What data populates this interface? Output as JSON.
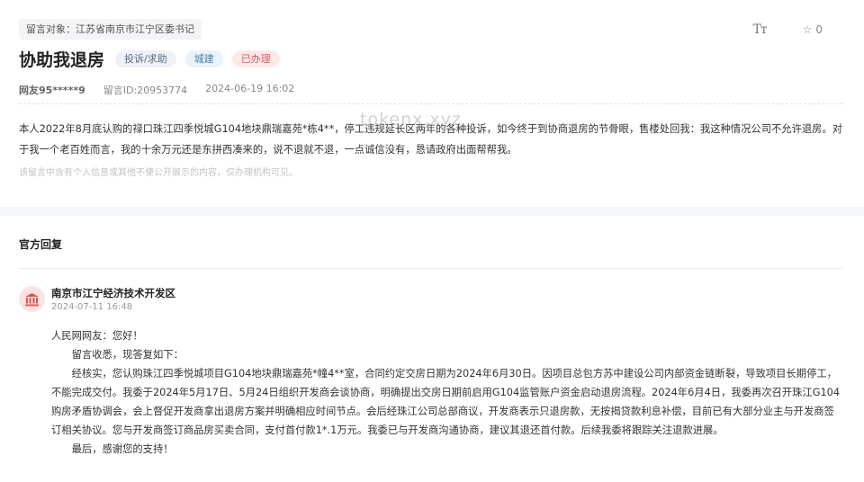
{
  "message": {
    "recipient": "留言对象：江苏省南京市江宁区委书记",
    "title": "协助我退房",
    "tags": [
      "投诉/求助",
      "城建",
      "已办理"
    ],
    "font_size_tool_icon": "Tт",
    "favorite_count": "0",
    "author": "网友95*****9",
    "message_id": "留言ID:20953774",
    "date": "2024-06-19 16:02",
    "content": "本人2022年8月底认购的禄口珠江四季悦城G104地块鼎瑞嘉苑*栋4**，停工违规延长区两年的各种投诉，如今终于到协商退房的节骨眼，售楼处回我：我这种情况公司不允许退房。对于我一个老百姓而言，我的十余万元还是东拼西凑来的，说不退就不退，一点诚信没有，恳请政府出面帮帮我。",
    "privacy_note": "该留言中含有个人信息或其他不便公开展示的内容，仅办理机构可见。"
  },
  "watermark": "tokenx.xyz",
  "reply": {
    "heading": "官方回复",
    "org_name": "南京市江宁经济技术开发区",
    "date": "2024-07-11 16:48",
    "greeting": "人民网网友：您好！",
    "ack": "留言收悉，现答复如下：",
    "body": "经核实，您认购珠江四季悦城项目G104地块鼎瑞嘉苑*幢4**室，合同约定交房日期为2024年6月30日。因项目总包方苏中建设公司内部资金链断裂，导致项目长期停工，不能完成交付。我委于2024年5月17日、5月24日组织开发商会谈协商，明确提出交房日期前启用G104监管账户资金启动退房流程。2024年6月4日，我委再次召开珠江G104购房矛盾协调会，会上督促开发商拿出退房方案并明确相应时间节点。会后经珠江公司总部商议，开发商表示只退房款，无按揭贷款利息补偿，目前已有大部分业主与开发商签订相关协议。您与开发商签订商品房买卖合同，支付首付款1*.1万元。我委已与开发商沟通协商，建议其退还首付款。后续我委将跟踪关注退款进展。",
    "closing": "最后，感谢您的支持！"
  },
  "colors": {
    "status_tag": "#d35a64",
    "field_tag": "#4a7fa8",
    "avatar_bg": "#fbe3e2",
    "avatar_icon": "#d9534f"
  },
  "icons": {
    "font_size": "font-size-icon",
    "favorite": "star-icon",
    "org_avatar": "government-building-icon"
  }
}
